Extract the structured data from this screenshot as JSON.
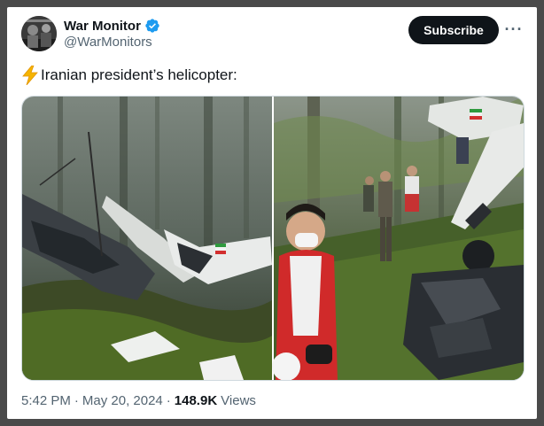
{
  "author": {
    "display_name": "War Monitor",
    "handle": "@WarMonitors",
    "verified_badge_color": "#1d9bf0"
  },
  "subscribe_label": "Subscribe",
  "more_icon_glyph": "···",
  "tweet": {
    "emoji": "⚡",
    "text": "Iranian president’s helicopter:"
  },
  "photos": [
    {
      "icon": "photo-wreckage-forest"
    },
    {
      "icon": "photo-rescue-team"
    }
  ],
  "meta": {
    "time": "5:42 PM",
    "separator1": "·",
    "date": "May 20, 2024",
    "separator2": "·",
    "views_count": "148.9K",
    "views_label": "Views"
  },
  "colors": {
    "text_primary": "#0f1419",
    "text_secondary": "#536471",
    "subscribe_bg": "#0f1419",
    "verified": "#1d9bf0"
  }
}
